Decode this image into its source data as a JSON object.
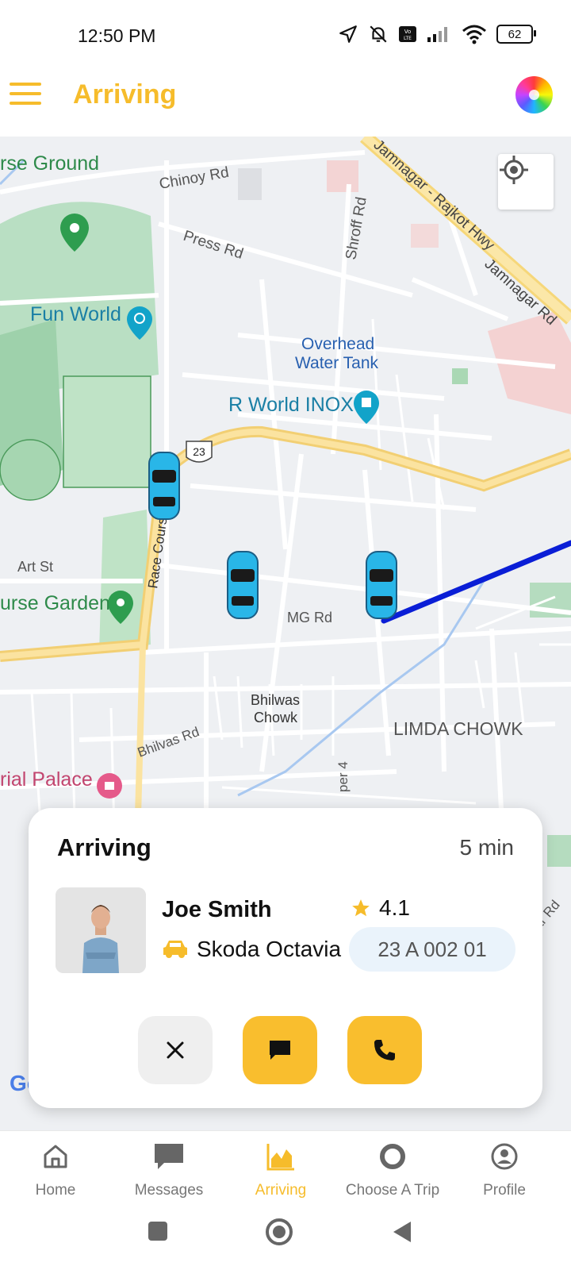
{
  "status_bar": {
    "time": "12:50 PM",
    "battery": "62"
  },
  "app_bar": {
    "title": "Arriving"
  },
  "map": {
    "labels": {
      "race_ground": "rse Ground",
      "chinoy_rd": "Chinoy Rd",
      "press_rd": "Press Rd",
      "shroff_rd": "Shroff Rd",
      "jamnagar_hwy": "Jamnagar - Rajkot Hwy",
      "jamnagar_rd": "Jamnagar Rd",
      "fun_world": "Fun World",
      "overhead_1": "Overhead",
      "overhead_2": "Water Tank",
      "r_world": "R World INOX",
      "highway_shield": "23",
      "race_course_rd": "Race Course",
      "art_st": "Art St",
      "race_garden": "urse Garden",
      "mg_rd": "MG Rd",
      "bhilwas_1": "Bhilwas",
      "bhilwas_2": "Chowk",
      "limda_chowk": "LIMDA CHOWK",
      "bhilvas_rd": "Bhilvas Rd",
      "imperial_palace": "rial Palace",
      "sher_4": "per 4",
      "google": "Google",
      "ar_rd": "ar Rd"
    }
  },
  "trip_card": {
    "status": "Arriving",
    "eta": "5 min",
    "driver_name": "Joe Smith",
    "rating": "4.1",
    "car_model": "Skoda Octavia",
    "plate": "23 A 002 01"
  },
  "bottom_nav": {
    "items": [
      {
        "label": "Home",
        "icon": "home-icon"
      },
      {
        "label": "Messages",
        "icon": "message-icon"
      },
      {
        "label": "Arriving",
        "icon": "chart-icon"
      },
      {
        "label": "Choose A Trip",
        "icon": "circle-icon"
      },
      {
        "label": "Profile",
        "icon": "profile-icon"
      }
    ],
    "active": "Arriving"
  },
  "colors": {
    "accent": "#F6BC2B",
    "route": "#0A1ED6",
    "car": "#29B6E8"
  }
}
